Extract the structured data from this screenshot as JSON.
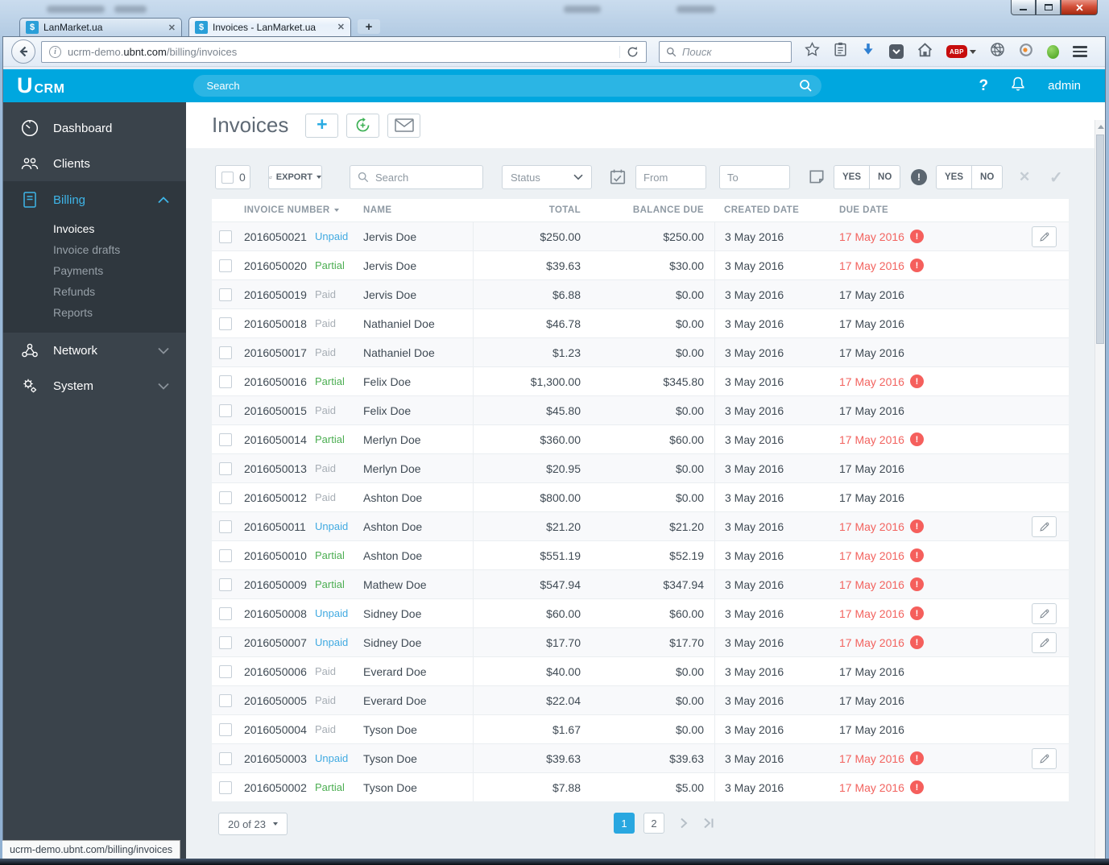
{
  "browser": {
    "tabs": [
      {
        "favicon": "$",
        "title": "LanMarket.ua"
      },
      {
        "favicon": "$",
        "title": "Invoices - LanMarket.ua"
      }
    ],
    "url": {
      "subdomain": "ucrm-demo.",
      "domain": "ubnt.com",
      "path": "/billing/invoices"
    },
    "search_placeholder": "Поиск",
    "abp_label": "ABP",
    "status_bar_text": "ucrm-demo.ubnt.com/billing/invoices"
  },
  "app": {
    "brand": {
      "u": "U",
      "crm": "CRM"
    },
    "topnav": {
      "search_placeholder": "Search",
      "help": "?",
      "user": "admin"
    },
    "sidebar": {
      "items": [
        {
          "label": "Dashboard"
        },
        {
          "label": "Clients"
        },
        {
          "label": "Billing"
        },
        {
          "label": "Network"
        },
        {
          "label": "System"
        }
      ],
      "billing_sub": [
        {
          "label": "Invoices"
        },
        {
          "label": "Invoice drafts"
        },
        {
          "label": "Payments"
        },
        {
          "label": "Refunds"
        },
        {
          "label": "Reports"
        }
      ]
    },
    "page": {
      "title": "Invoices"
    },
    "toolbar": {
      "selected_count": "0",
      "export_label": "EXPORT",
      "search_placeholder": "Search",
      "status_placeholder": "Status",
      "from_placeholder": "From",
      "to_placeholder": "To",
      "yes": "YES",
      "no": "NO"
    },
    "table": {
      "headers": [
        "INVOICE NUMBER",
        "NAME",
        "TOTAL",
        "BALANCE DUE",
        "CREATED DATE",
        "DUE DATE"
      ],
      "rows": [
        {
          "number": "2016050021",
          "status": "Unpaid",
          "name": "Jervis Doe",
          "total": "$250.00",
          "balance": "$250.00",
          "created": "3 May 2016",
          "due": "17 May 2016",
          "overdue": true,
          "editable": true
        },
        {
          "number": "2016050020",
          "status": "Partial",
          "name": "Jervis Doe",
          "total": "$39.63",
          "balance": "$30.00",
          "created": "3 May 2016",
          "due": "17 May 2016",
          "overdue": true,
          "editable": false
        },
        {
          "number": "2016050019",
          "status": "Paid",
          "name": "Jervis Doe",
          "total": "$6.88",
          "balance": "$0.00",
          "created": "3 May 2016",
          "due": "17 May 2016",
          "overdue": false,
          "editable": false
        },
        {
          "number": "2016050018",
          "status": "Paid",
          "name": "Nathaniel Doe",
          "total": "$46.78",
          "balance": "$0.00",
          "created": "3 May 2016",
          "due": "17 May 2016",
          "overdue": false,
          "editable": false
        },
        {
          "number": "2016050017",
          "status": "Paid",
          "name": "Nathaniel Doe",
          "total": "$1.23",
          "balance": "$0.00",
          "created": "3 May 2016",
          "due": "17 May 2016",
          "overdue": false,
          "editable": false
        },
        {
          "number": "2016050016",
          "status": "Partial",
          "name": "Felix Doe",
          "total": "$1,300.00",
          "balance": "$345.80",
          "created": "3 May 2016",
          "due": "17 May 2016",
          "overdue": true,
          "editable": false
        },
        {
          "number": "2016050015",
          "status": "Paid",
          "name": "Felix Doe",
          "total": "$45.80",
          "balance": "$0.00",
          "created": "3 May 2016",
          "due": "17 May 2016",
          "overdue": false,
          "editable": false
        },
        {
          "number": "2016050014",
          "status": "Partial",
          "name": "Merlyn Doe",
          "total": "$360.00",
          "balance": "$60.00",
          "created": "3 May 2016",
          "due": "17 May 2016",
          "overdue": true,
          "editable": false
        },
        {
          "number": "2016050013",
          "status": "Paid",
          "name": "Merlyn Doe",
          "total": "$20.95",
          "balance": "$0.00",
          "created": "3 May 2016",
          "due": "17 May 2016",
          "overdue": false,
          "editable": false
        },
        {
          "number": "2016050012",
          "status": "Paid",
          "name": "Ashton Doe",
          "total": "$800.00",
          "balance": "$0.00",
          "created": "3 May 2016",
          "due": "17 May 2016",
          "overdue": false,
          "editable": false
        },
        {
          "number": "2016050011",
          "status": "Unpaid",
          "name": "Ashton Doe",
          "total": "$21.20",
          "balance": "$21.20",
          "created": "3 May 2016",
          "due": "17 May 2016",
          "overdue": true,
          "editable": true
        },
        {
          "number": "2016050010",
          "status": "Partial",
          "name": "Ashton Doe",
          "total": "$551.19",
          "balance": "$52.19",
          "created": "3 May 2016",
          "due": "17 May 2016",
          "overdue": true,
          "editable": false
        },
        {
          "number": "2016050009",
          "status": "Partial",
          "name": "Mathew Doe",
          "total": "$547.94",
          "balance": "$347.94",
          "created": "3 May 2016",
          "due": "17 May 2016",
          "overdue": true,
          "editable": false
        },
        {
          "number": "2016050008",
          "status": "Unpaid",
          "name": "Sidney Doe",
          "total": "$60.00",
          "balance": "$60.00",
          "created": "3 May 2016",
          "due": "17 May 2016",
          "overdue": true,
          "editable": true
        },
        {
          "number": "2016050007",
          "status": "Unpaid",
          "name": "Sidney Doe",
          "total": "$17.70",
          "balance": "$17.70",
          "created": "3 May 2016",
          "due": "17 May 2016",
          "overdue": true,
          "editable": true
        },
        {
          "number": "2016050006",
          "status": "Paid",
          "name": "Everard Doe",
          "total": "$40.00",
          "balance": "$0.00",
          "created": "3 May 2016",
          "due": "17 May 2016",
          "overdue": false,
          "editable": false
        },
        {
          "number": "2016050005",
          "status": "Paid",
          "name": "Everard Doe",
          "total": "$22.04",
          "balance": "$0.00",
          "created": "3 May 2016",
          "due": "17 May 2016",
          "overdue": false,
          "editable": false
        },
        {
          "number": "2016050004",
          "status": "Paid",
          "name": "Tyson Doe",
          "total": "$1.67",
          "balance": "$0.00",
          "created": "3 May 2016",
          "due": "17 May 2016",
          "overdue": false,
          "editable": false
        },
        {
          "number": "2016050003",
          "status": "Unpaid",
          "name": "Tyson Doe",
          "total": "$39.63",
          "balance": "$39.63",
          "created": "3 May 2016",
          "due": "17 May 2016",
          "overdue": true,
          "editable": true
        },
        {
          "number": "2016050002",
          "status": "Partial",
          "name": "Tyson Doe",
          "total": "$7.88",
          "balance": "$5.00",
          "created": "3 May 2016",
          "due": "17 May 2016",
          "overdue": true,
          "editable": false
        }
      ]
    },
    "pagination": {
      "size_label": "20 of 23",
      "pages": [
        "1",
        "2"
      ],
      "active_page": "1"
    }
  },
  "colors": {
    "accent": "#00a7df",
    "unpaid": "#41aae1",
    "partial": "#4cae52",
    "paid": "#a7aeb5",
    "overdue": "#f2635f",
    "sidebar_bg": "#3a434b"
  }
}
